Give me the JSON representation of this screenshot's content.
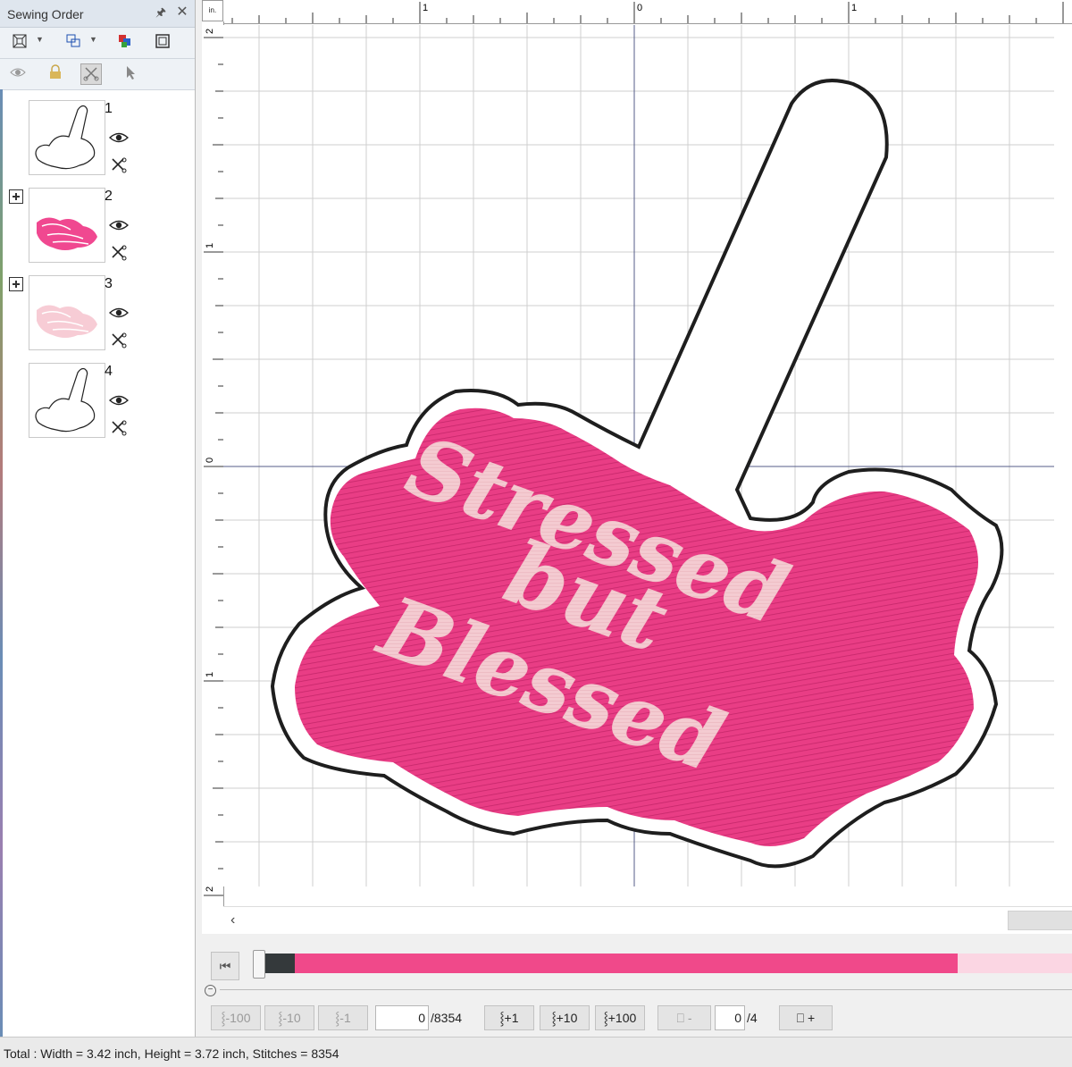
{
  "panel": {
    "title": "Sewing Order",
    "pin_icon": "pin-icon",
    "close_icon": "close-icon"
  },
  "toolbar": {
    "fit_icon": "fit-to-window-icon",
    "group_icon": "group-objects-icon",
    "color_sort_icon": "color-sort-icon",
    "frame_icon": "frame-icon",
    "eye_icon": "visibility-icon",
    "lock_icon": "lock-icon",
    "cut_icon": "scissors-icon",
    "select_icon": "select-arrow-icon"
  },
  "sewing_order": [
    {
      "number": "1",
      "color": "#ffffff",
      "stroke": "#222222",
      "expandable": false
    },
    {
      "number": "2",
      "color": "#ef3e8a",
      "stroke": "#ef3e8a",
      "expandable": true
    },
    {
      "number": "3",
      "color": "#f7c9d3",
      "stroke": "#f7c9d3",
      "expandable": true
    },
    {
      "number": "4",
      "color": "#ffffff",
      "stroke": "#222222",
      "expandable": false
    }
  ],
  "ruler": {
    "unit": "in.",
    "h_labels": [
      "1",
      "0",
      "1"
    ],
    "v_labels": [
      "2",
      "1",
      "0",
      "1",
      "2"
    ]
  },
  "design": {
    "line1": "Stressed",
    "line2": "but",
    "line3": "Blessed",
    "fill_color": "#ec3f86",
    "text_color": "#f3c8cf",
    "outline_color": "#1e1e1e"
  },
  "playback": {
    "current_stitch": "0",
    "total_stitch": "/8354",
    "current_color": "0",
    "total_color": "/4",
    "btn_minus100": "-100",
    "btn_minus10": "-10",
    "btn_minus1": "-1",
    "btn_plus1": "+1",
    "btn_plus10": "+10",
    "btn_plus100": "+100",
    "btn_color_minus": "-",
    "btn_color_plus": "+",
    "progress_fraction": 0.0
  },
  "status": {
    "text": "Total : Width = 3.42 inch, Height = 3.72 inch, Stitches = 8354"
  }
}
